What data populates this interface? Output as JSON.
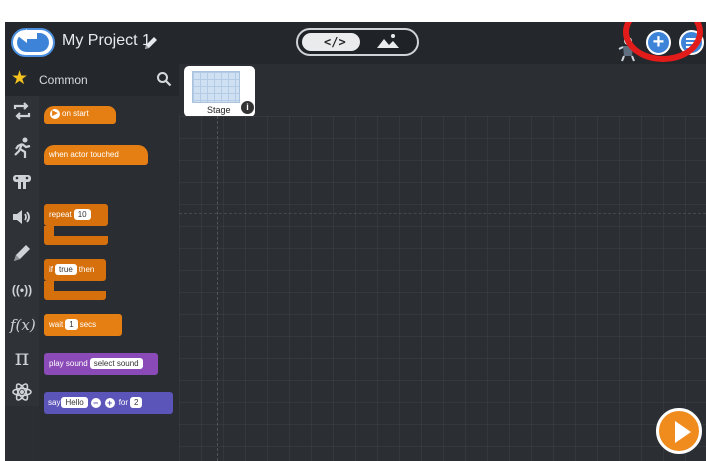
{
  "header": {
    "project_title": "My Project 1",
    "view_toggle": {
      "code_label": "</>",
      "scene_icon": "scene-icon"
    }
  },
  "category": {
    "name": "Common",
    "icon": "star-icon"
  },
  "categories": [
    "repeat-icon",
    "runner-icon",
    "gamepad-icon",
    "sound-icon",
    "pen-icon",
    "broadcast-icon",
    "function-icon",
    "pi-icon",
    "atom-icon"
  ],
  "blocks": {
    "on_start": "on start",
    "when_touched": "when actor touched",
    "repeat_label": "repeat",
    "repeat_value": "10",
    "if_label": "if",
    "if_value": "true",
    "then_label": "then",
    "wait_label": "wait",
    "wait_value": "1",
    "secs_label": "secs",
    "play_label": "play sound",
    "sound_value": "select sound",
    "say_label": "say",
    "say_value": "Hello",
    "minus": "−",
    "plus": "+",
    "for_label": "for",
    "for_value": "2"
  },
  "stage": {
    "label": "Stage",
    "info": "i"
  },
  "colors": {
    "accent_blue": "#3d84d9",
    "event_orange": "#e67f13",
    "sound_purple": "#8a4ab8",
    "looks_blue": "#5c55b9",
    "highlight_red": "#e21b1b"
  }
}
